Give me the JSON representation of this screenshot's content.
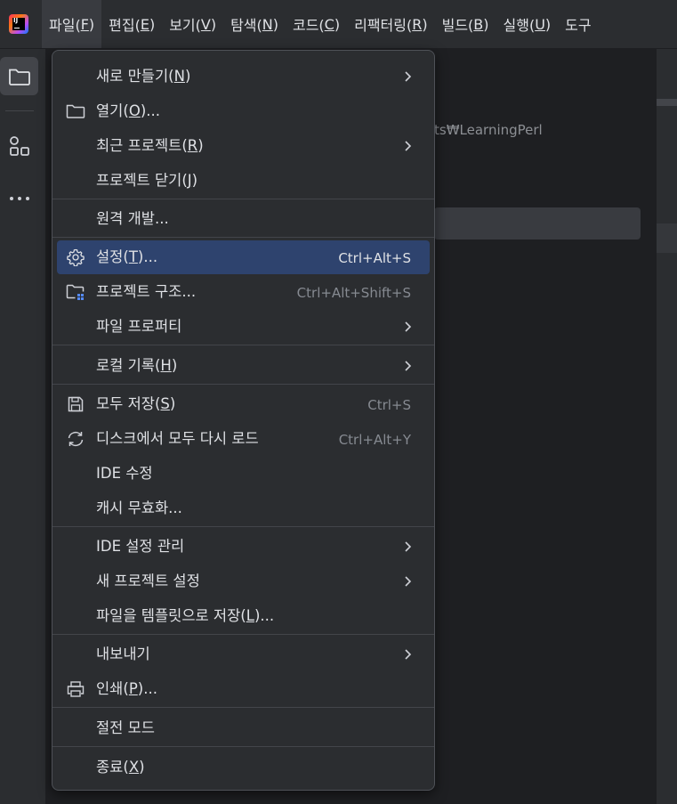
{
  "menubar": {
    "items": [
      {
        "label": "파일(",
        "mnemonic": "F",
        "suffix": ")",
        "active": true
      },
      {
        "label": "편집(",
        "mnemonic": "E",
        "suffix": ")"
      },
      {
        "label": "보기(",
        "mnemonic": "V",
        "suffix": ")"
      },
      {
        "label": "탐색(",
        "mnemonic": "N",
        "suffix": ")"
      },
      {
        "label": "코드(",
        "mnemonic": "C",
        "suffix": ")"
      },
      {
        "label": "리팩터링(",
        "mnemonic": "R",
        "suffix": ")"
      },
      {
        "label": "빌드(",
        "mnemonic": "B",
        "suffix": ")"
      },
      {
        "label": "실행(",
        "mnemonic": "U",
        "suffix": ")"
      },
      {
        "label": "도구",
        "mnemonic": "",
        "suffix": ""
      }
    ]
  },
  "logo": {
    "text": "IJ"
  },
  "background": {
    "path_fragment": "ts₩LearningPerl"
  },
  "file_menu": {
    "items": [
      {
        "name": "new",
        "label": "새로 만들기(",
        "mnemonic": "N",
        "suffix": ")",
        "submenu": true
      },
      {
        "name": "open",
        "label": "열기(",
        "mnemonic": "O",
        "suffix": ")...",
        "icon": "folder-icon"
      },
      {
        "name": "recent-projects",
        "label": "최근 프로젝트(",
        "mnemonic": "R",
        "suffix": ")",
        "submenu": true
      },
      {
        "name": "close-project",
        "label": "프로젝트 닫기(",
        "mnemonic": "J",
        "suffix": ")"
      },
      {
        "name": "remote-dev",
        "label": "원격 개발...",
        "mnemonic": "",
        "suffix": ""
      },
      {
        "name": "settings",
        "label": "설정(",
        "mnemonic": "T",
        "suffix": ")...",
        "shortcut": "Ctrl+Alt+S",
        "icon": "gear-icon",
        "selected": true
      },
      {
        "name": "project-structure",
        "label": "프로젝트 구조...",
        "mnemonic": "",
        "suffix": "",
        "shortcut": "Ctrl+Alt+Shift+S",
        "icon": "project-structure-icon"
      },
      {
        "name": "file-properties",
        "label": "파일 프로퍼티",
        "mnemonic": "",
        "suffix": "",
        "submenu": true
      },
      {
        "name": "local-history",
        "label": "로컬 기록(",
        "mnemonic": "H",
        "suffix": ")",
        "submenu": true
      },
      {
        "name": "save-all",
        "label": "모두 저장(",
        "mnemonic": "S",
        "suffix": ")",
        "shortcut": "Ctrl+S",
        "icon": "save-icon"
      },
      {
        "name": "reload-from-disk",
        "label": "디스크에서 모두 다시 로드",
        "mnemonic": "",
        "suffix": "",
        "shortcut": "Ctrl+Alt+Y",
        "icon": "reload-icon"
      },
      {
        "name": "repair-ide",
        "label": "IDE 수정",
        "mnemonic": "",
        "suffix": ""
      },
      {
        "name": "invalidate-caches",
        "label": "캐시 무효화...",
        "mnemonic": "",
        "suffix": ""
      },
      {
        "name": "manage-ide-settings",
        "label": "IDE 설정 관리",
        "mnemonic": "",
        "suffix": "",
        "submenu": true
      },
      {
        "name": "new-project-setup",
        "label": "새 프로젝트 설정",
        "mnemonic": "",
        "suffix": "",
        "submenu": true
      },
      {
        "name": "save-as-template",
        "label": "파일을 템플릿으로 저장(",
        "mnemonic": "L",
        "suffix": ")...",
        "mnemonic_dots_underlined": true
      },
      {
        "name": "export",
        "label": "내보내기",
        "mnemonic": "",
        "suffix": "",
        "submenu": true
      },
      {
        "name": "print",
        "label": "인쇄(",
        "mnemonic": "P",
        "suffix": ")...",
        "icon": "print-icon"
      },
      {
        "name": "power-save-mode",
        "label": "절전 모드",
        "mnemonic": "",
        "suffix": ""
      },
      {
        "name": "exit",
        "label": "종료(",
        "mnemonic": "X",
        "suffix": ")"
      }
    ]
  },
  "toolstrip": {
    "items": [
      "project-folder-icon",
      "structure-icon",
      "more-icon"
    ]
  },
  "colors": {
    "background": "#1e1f22",
    "panel": "#2b2d30",
    "selection": "#2e436e",
    "text": "#dfe1e5",
    "shortcut_text": "#868a91",
    "separator": "#43454a"
  }
}
